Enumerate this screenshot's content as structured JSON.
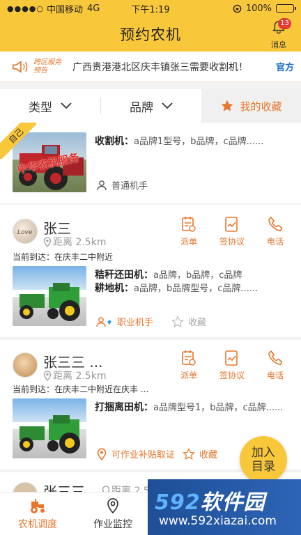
{
  "status": {
    "signal": "●●●●○",
    "carrier": "中国移动",
    "network": "4G",
    "time": "下午1:19",
    "battery": "100%",
    "battery_level": 1.0
  },
  "nav": {
    "title": "预约农机",
    "message_label": "消息",
    "message_badge": "13"
  },
  "notice": {
    "tag": "跨区服务预告",
    "text": "广西贵港港北区庆丰镇张三需要收割机！",
    "official": "官方"
  },
  "filters": {
    "type_label": "类型",
    "brand_label": "品牌",
    "favorites_label": "我的收藏"
  },
  "cards": [
    {
      "ribbon": "自己",
      "machine_label": "收割机：",
      "machine_value": "a品牌1型号，b品牌，c品牌......",
      "operator_type": "普通机手",
      "thumb_overlay": "中华农机服务"
    },
    {
      "name": "张三",
      "distance": "距离 2.5km",
      "location": "当前到达：在庆丰二中附近",
      "actions": [
        "派单",
        "签协议",
        "电话"
      ],
      "machines": [
        {
          "label": "秸秆还田机：",
          "value": "a品牌，b品牌，c品牌"
        },
        {
          "label": "耕地机：",
          "value": "a品牌，b品牌型号，c品牌......"
        }
      ],
      "operator_type": "职业机手",
      "collect_label": "收藏"
    },
    {
      "name": "张三三 ...",
      "distance": "距离 2.5km",
      "location": "当前到达：在庆丰二中附近在庆丰 ...",
      "actions": [
        "派单",
        "签协议",
        "电话"
      ],
      "machines": [
        {
          "label": "打捆离田机：",
          "value": "a品牌型号1，b品牌，c品牌......"
        }
      ],
      "subsidy": "可作业补贴取证",
      "collect_label": "收藏"
    },
    {
      "name": "张三三",
      "distance": "距离 2.5"
    }
  ],
  "add_button": {
    "line1": "加入",
    "line2": "目录"
  },
  "tabs": [
    {
      "label": "农机调度",
      "active": true
    },
    {
      "label": "作业监控",
      "active": false
    },
    {
      "label": "",
      "active": false
    },
    {
      "label": "",
      "active": false
    }
  ],
  "watermark": {
    "logo_prefix": "592",
    "logo_suffix": "软件园",
    "url": "www.592xiazai.com"
  },
  "colors": {
    "brand_yellow": "#f9c73a",
    "accent_orange": "#e8762b",
    "official_blue": "#1f6fc1"
  }
}
